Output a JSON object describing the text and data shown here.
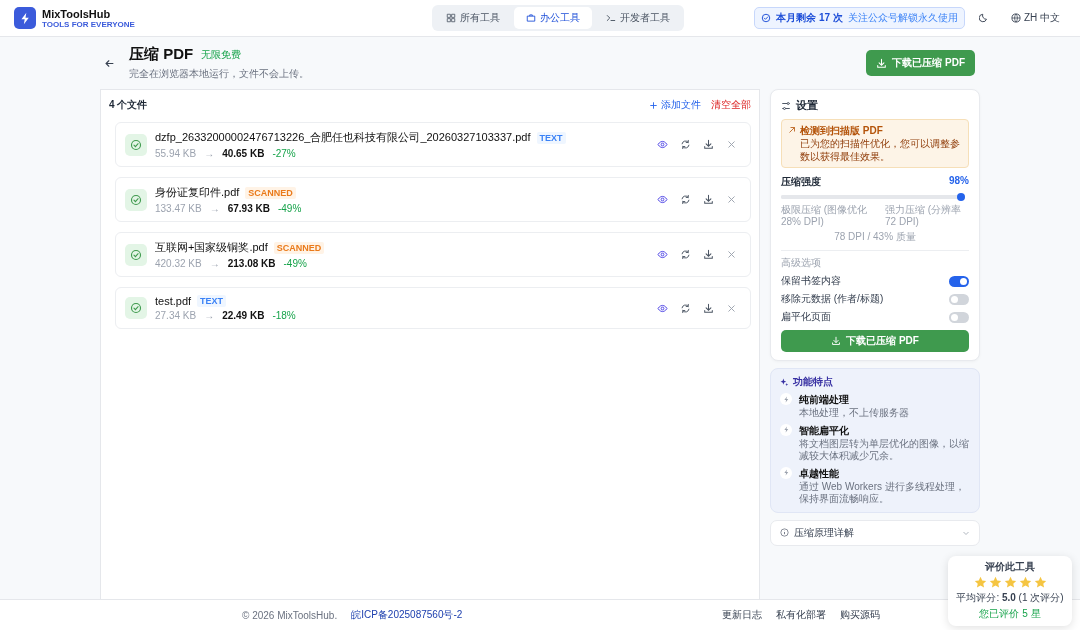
{
  "header": {
    "logo_title": "MixToolsHub",
    "logo_subtitle": "TOOLS FOR EVERYONE",
    "tabs": [
      {
        "label": "所有工具",
        "selected": false
      },
      {
        "label": "办公工具",
        "selected": true
      },
      {
        "label": "开发者工具",
        "selected": false
      }
    ],
    "quota": {
      "label": "本月剩余 17 次",
      "hint": "关注公众号解锁永久使用"
    },
    "language": "ZH 中文"
  },
  "page": {
    "title": "压缩 PDF",
    "badge": "无限免费",
    "subtitle": "完全在浏览器本地运行，文件不会上传。",
    "download_button": "下载已压缩 PDF"
  },
  "files": {
    "count": "4 个文件",
    "add": "添加文件",
    "clear": "清空全部",
    "items": [
      {
        "name": "dzfp_26332000002476713226_合肥任也科技有限公司_20260327103337.pdf",
        "tag": "TEXT",
        "kind": "text",
        "original": "55.94 KB",
        "arrow": "→",
        "compressed": "40.65 KB",
        "change": "-27%"
      },
      {
        "name": "身份证复印件.pdf",
        "tag": "SCANNED",
        "kind": "scanned",
        "original": "133.47 KB",
        "arrow": "→",
        "compressed": "67.93 KB",
        "change": "-49%"
      },
      {
        "name": "互联网+国家级铜奖.pdf",
        "tag": "SCANNED",
        "kind": "scanned",
        "original": "420.32 KB",
        "arrow": "→",
        "compressed": "213.08 KB",
        "change": "-49%"
      },
      {
        "name": "test.pdf",
        "tag": "TEXT",
        "kind": "text",
        "original": "27.34 KB",
        "arrow": "→",
        "compressed": "22.49 KB",
        "change": "-18%"
      }
    ]
  },
  "settings": {
    "title": "设置",
    "notice": {
      "title": "检测到扫描版 PDF",
      "text": "已为您的扫描件优化，您可以调整参数以获得最佳效果。"
    },
    "strength": {
      "label": "压缩强度",
      "reading": "98%",
      "level": 0.98,
      "left_hint": "极限压缩 (图像优化 28% DPI)",
      "right_hint": "强力压缩 (分辨率 72 DPI)",
      "summary": "78 DPI / 43% 质量"
    },
    "options_heading": "高级选项",
    "options": [
      {
        "label": "保留书签内容",
        "on": true
      },
      {
        "label": "移除元数据 (作者/标题)",
        "on": false
      },
      {
        "label": "扁平化页面",
        "on": false
      }
    ],
    "download_button": "下载已压缩 PDF"
  },
  "features": {
    "title": "功能特点",
    "items": [
      {
        "title": "纯前端处理",
        "text": "本地处理，不上传服务器"
      },
      {
        "title": "智能扁平化",
        "text": "将文档图层转为单层优化的图像，以缩减较大体积减少冗余。"
      },
      {
        "title": "卓越性能",
        "text": "通过 Web Workers 进行多线程处理，保持界面流畅响应。"
      }
    ]
  },
  "details": {
    "label": "压缩原理详解"
  },
  "rating": {
    "title": "评价此工具",
    "stars": 5,
    "summary": "平均评分: **5.0** (1 次评分)",
    "note": "您已评价 5 星"
  },
  "footer": {
    "copyright": "© 2026 MixToolsHub.",
    "icp": "皖ICP备2025087560号-2",
    "links": [
      "更新日志",
      "私有化部署",
      "购买源码"
    ]
  }
}
